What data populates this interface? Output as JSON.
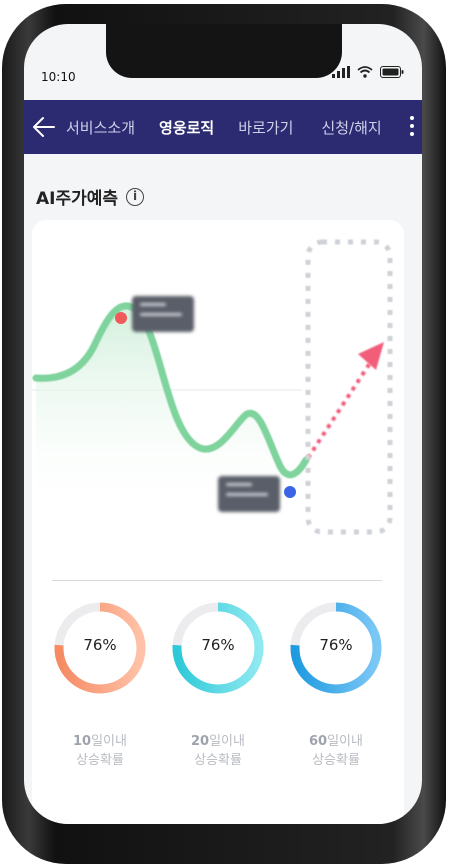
{
  "status": {
    "time": "10:10"
  },
  "nav": {
    "tabs": [
      {
        "label": "서비스소개"
      },
      {
        "label": "영웅로직"
      },
      {
        "label": "바로가기"
      },
      {
        "label": "신청/해지"
      }
    ]
  },
  "section": {
    "title": "AI주가예측",
    "info_icon": "i"
  },
  "colors": {
    "nav_bg": "#2c2a71",
    "line": "#7fd39d",
    "peak": "#f05a5a",
    "low": "#3b63e6",
    "arrow": "#f25d7a"
  },
  "probabilities": [
    {
      "value": "76%",
      "fraction": 0.76,
      "label_num": "10",
      "label_unit": "일이내",
      "label_sub": "상승확률",
      "color_start": "#f58a63",
      "color_end": "#ffc2a8"
    },
    {
      "value": "76%",
      "fraction": 0.76,
      "label_num": "20",
      "label_unit": "일이내",
      "label_sub": "상승확률",
      "color_start": "#2ec9d8",
      "color_end": "#8fe9f0"
    },
    {
      "value": "76%",
      "fraction": 0.76,
      "label_num": "60",
      "label_unit": "일이내",
      "label_sub": "상승확률",
      "color_start": "#1e9ae0",
      "color_end": "#7cc8f5"
    }
  ]
}
